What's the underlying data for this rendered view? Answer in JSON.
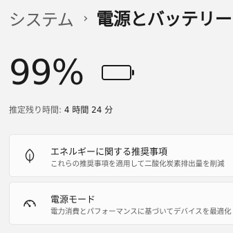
{
  "breadcrumb": {
    "parent": "システム",
    "separator": "›",
    "current": "電源とバッテリー"
  },
  "battery": {
    "percent_label": "99%",
    "level": 0.99,
    "remaining_label": "推定残り時間:",
    "remaining_value": "4 時間 24 分"
  },
  "cards": [
    {
      "icon": "leaf-icon",
      "title": "エネルギーに関する推奨事項",
      "description": "これらの推奨事項を適用して二酸化炭素排出量を削減"
    },
    {
      "icon": "gauge-icon",
      "title": "電源モード",
      "description": "電力消費とパフォーマンスに基づいてデバイスを最適化"
    }
  ]
}
